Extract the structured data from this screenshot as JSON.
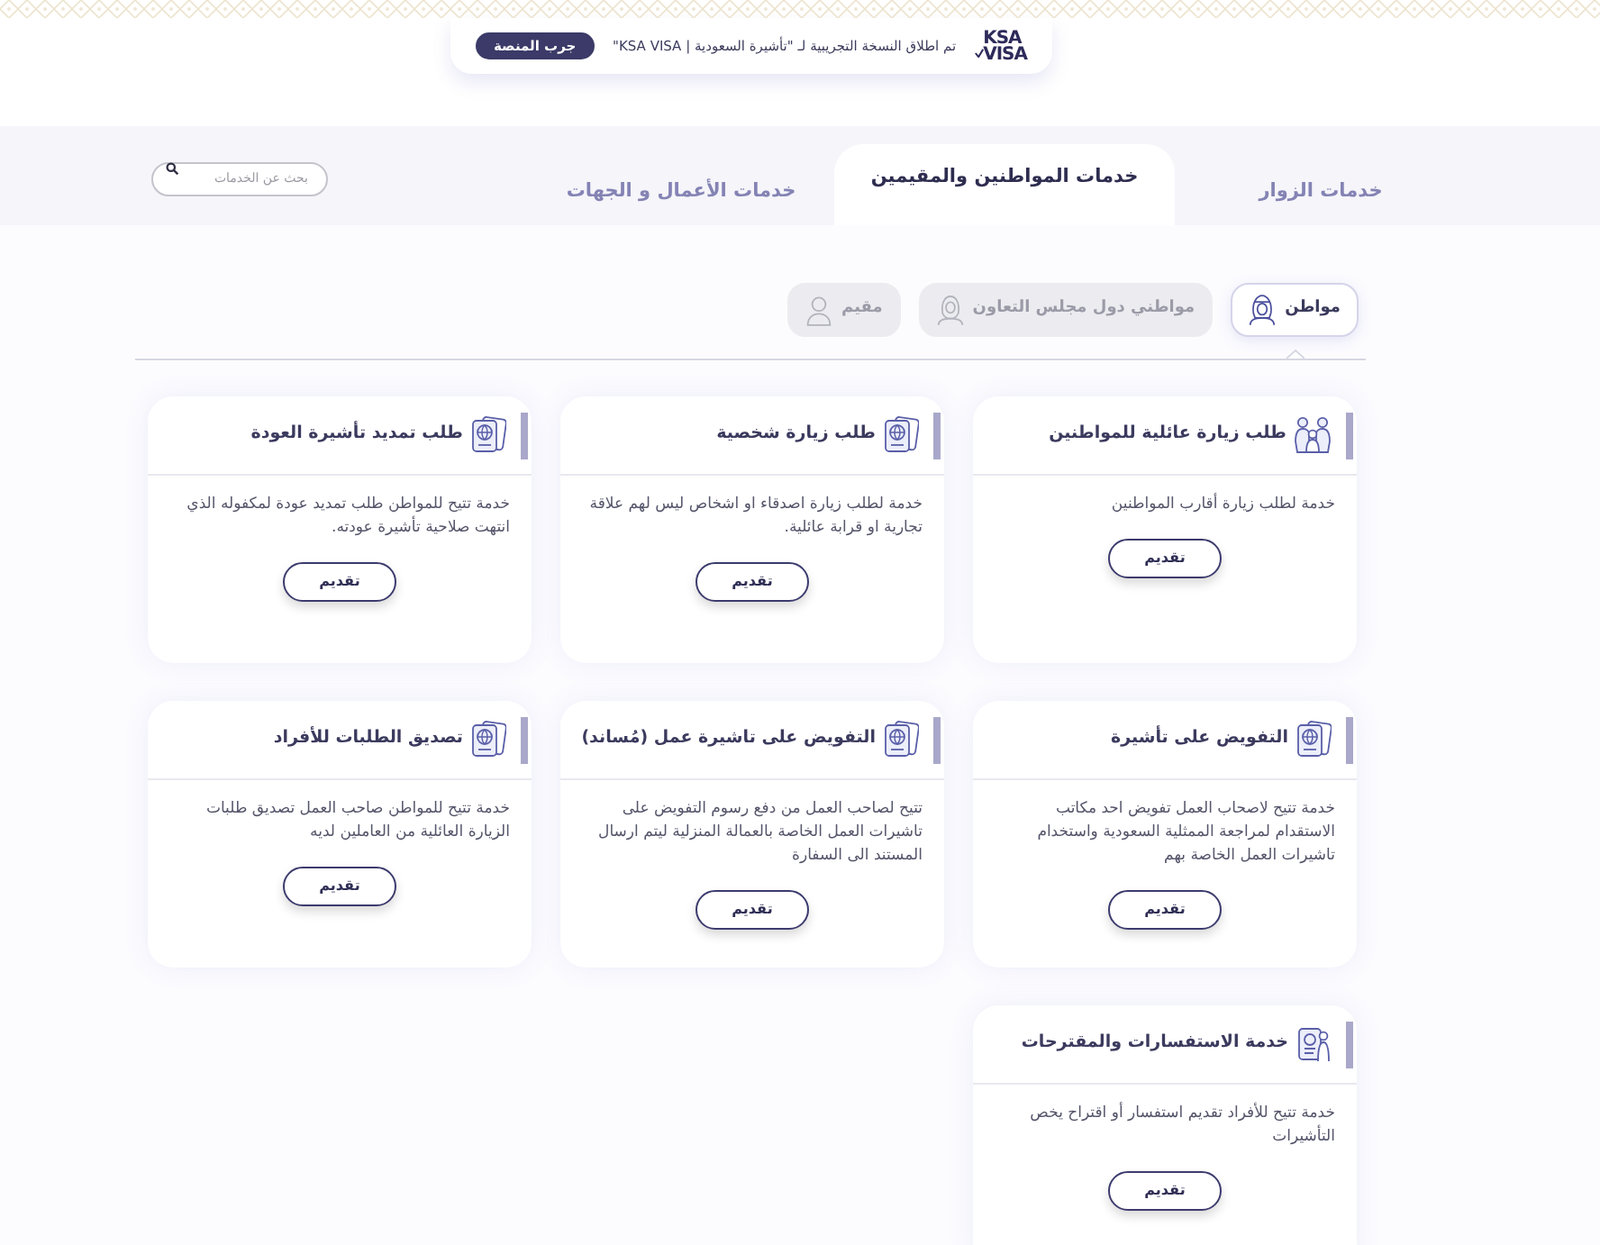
{
  "banner": {
    "logo": [
      "KSA",
      "VISA"
    ],
    "message": "تم اطلاق النسخة التجريبية لـ \"تأشيرة السعودية | KSA VISA\"",
    "button": "جرب المنصة"
  },
  "tabs": [
    {
      "label": "خدمات الزوار",
      "selected": false
    },
    {
      "label": "خدمات المواطنين والمقيمين",
      "selected": true
    },
    {
      "label": "خدمات الأعمال و الجهات",
      "selected": false
    }
  ],
  "search": {
    "placeholder": "بحث عن الخدمات"
  },
  "audience_tabs": [
    {
      "label": "مواطن",
      "selected": true
    },
    {
      "label": "مواطني دول مجلس التعاون",
      "selected": false
    },
    {
      "label": "مقيم",
      "selected": false
    }
  ],
  "services": [
    {
      "title": "طلب زيارة عائلية للمواطنين",
      "description": "خدمة لطلب زيارة أقارب المواطنين",
      "button": "تقديم"
    },
    {
      "title": "طلب زيارة شخصية",
      "description": "خدمة لطلب زيارة اصدقاء او اشخاص ليس لهم علاقة تجارية او قرابة عائلية.",
      "button": "تقديم"
    },
    {
      "title": "طلب تمديد تأشيرة العودة",
      "description": "خدمة تتيح للمواطن طلب تمديد عودة لمكفوله الذي انتهت صلاحية تأشيرة عودته.",
      "button": "تقديم"
    },
    {
      "title": "التفويض على تأشيرة",
      "description": "خدمة تتيح لاصحاب العمل تفويض احد مكاتب الاستقدام لمراجعة الممثلية السعودية واستخدام تاشيرات العمل الخاصة بهم",
      "button": "تقديم"
    },
    {
      "title": "التفويض على تاشيرة عمل (مُساند)",
      "description": "تتيح لصاحب العمل من دفع رسوم التفويض على تاشيرات العمل الخاصة بالعمالة المنزلية ليتم ارسال المستند الى السفارة",
      "button": "تقديم"
    },
    {
      "title": "تصديق الطلبات للأفراد",
      "description": "خدمة تتيح للمواطن صاحب العمل تصديق طلبات الزيارة العائلية من العاملين لديه",
      "button": "تقديم"
    },
    {
      "title": "خدمة الاستفسارات والمقترحات",
      "description": "خدمة تتيح للأفراد تقديم استفسار أو اقتراح يخص التأشيرات",
      "button": "تقديم"
    }
  ]
}
